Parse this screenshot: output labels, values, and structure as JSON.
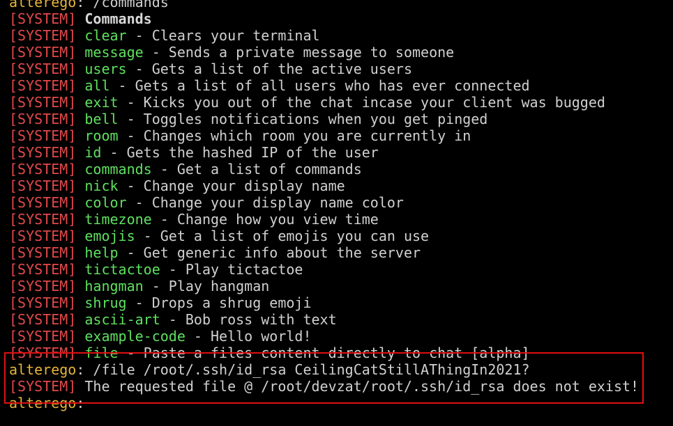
{
  "prompt": {
    "user": "alterego",
    "separator": ": ",
    "command": "/commands"
  },
  "system_tag": "[SYSTEM]",
  "commands_header": "Commands",
  "commands": [
    {
      "name": "clear",
      "desc": " - Clears your terminal"
    },
    {
      "name": "message",
      "desc": " - Sends a private message to someone"
    },
    {
      "name": "users",
      "desc": " - Gets a list of the active users"
    },
    {
      "name": "all",
      "desc": " - Gets a list of all users who has ever connected"
    },
    {
      "name": "exit",
      "desc": " - Kicks you out of the chat incase your client was bugged"
    },
    {
      "name": "bell",
      "desc": " - Toggles notifications when you get pinged"
    },
    {
      "name": "room",
      "desc": " - Changes which room you are currently in"
    },
    {
      "name": "id",
      "desc": " - Gets the hashed IP of the user"
    },
    {
      "name": "commands",
      "desc": " - Get a list of commands"
    },
    {
      "name": "nick",
      "desc": " - Change your display name"
    },
    {
      "name": "color",
      "desc": " - Change your display name color"
    },
    {
      "name": "timezone",
      "desc": " - Change how you view time"
    },
    {
      "name": "emojis",
      "desc": " - Get a list of emojis you can use"
    },
    {
      "name": "help",
      "desc": " - Get generic info about the server"
    },
    {
      "name": "tictactoe",
      "desc": " - Play tictactoe"
    },
    {
      "name": "hangman",
      "desc": " - Play hangman"
    },
    {
      "name": "shrug",
      "desc": " - Drops a shrug emoji"
    },
    {
      "name": "ascii-art",
      "desc": " - Bob ross with text"
    },
    {
      "name": "example-code",
      "desc": " - Hello world!"
    },
    {
      "name": "file",
      "desc": " - Paste a files content directly to chat [alpha]"
    }
  ],
  "file_prompt": {
    "user": "alterego",
    "separator": ": ",
    "command": "/file /root/.ssh/id_rsa CeilingCatStillAThingIn2021?"
  },
  "error_message": "The requested file @ /root/devzat/root/.ssh/id_rsa does not exist!",
  "final_prompt": {
    "user": "alterego",
    "separator": ":"
  },
  "colors": {
    "background": "#000000",
    "username": "#e8b43c",
    "system_tag": "#e2494b",
    "command_name": "#5fe05f",
    "text": "#d0d0d0",
    "highlight_border": "#e01010"
  }
}
